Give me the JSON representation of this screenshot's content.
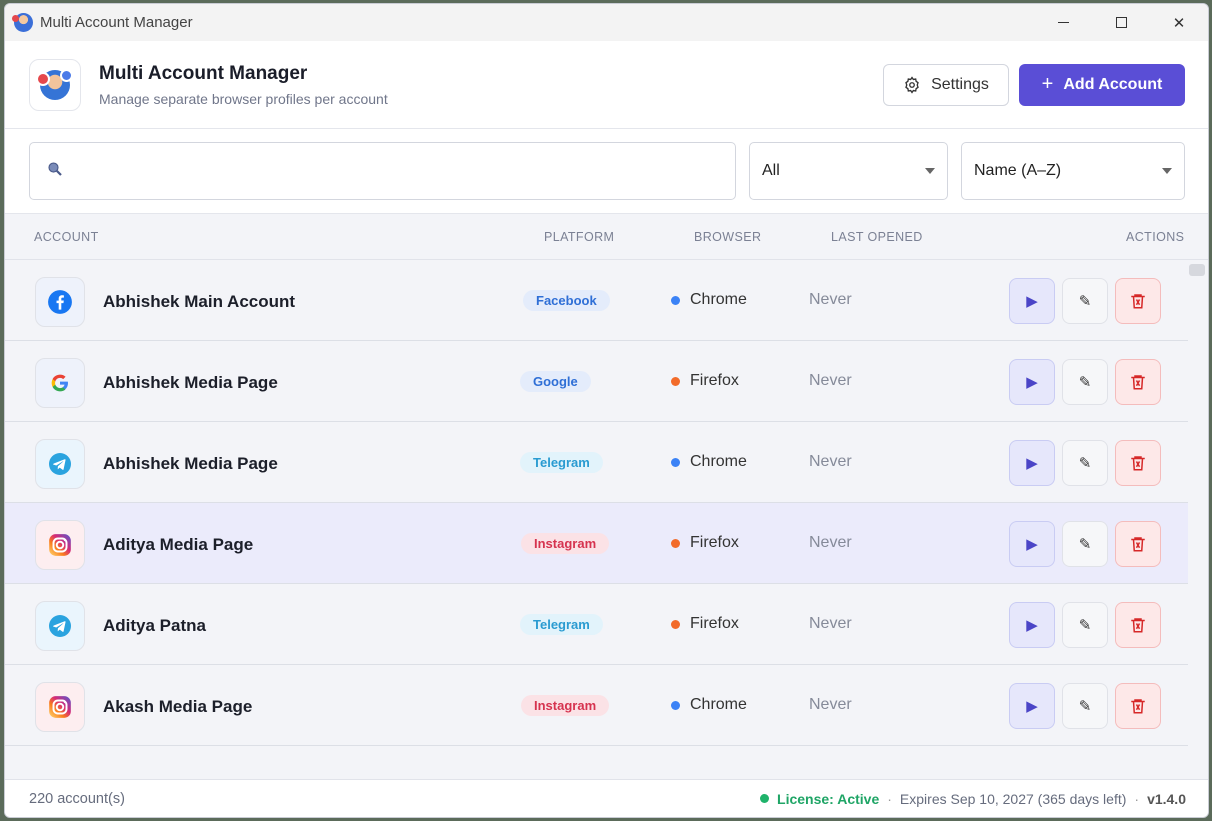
{
  "window": {
    "title": "Multi Account Manager"
  },
  "header": {
    "title": "Multi Account Manager",
    "subtitle": "Manage separate browser profiles per account",
    "settings_label": "Settings",
    "add_label": "Add Account",
    "add_plus": "+"
  },
  "filters": {
    "search_placeholder": "",
    "platform_value": "All",
    "sort_value": "Name (A–Z)"
  },
  "table": {
    "columns": {
      "account": "ACCOUNT",
      "platform": "PLATFORM",
      "browser": "BROWSER",
      "last_opened": "LAST OPENED",
      "actions": "ACTIONS"
    },
    "rows": [
      {
        "name": "Abhishek Main Account",
        "platform": "Facebook",
        "browser": "Chrome",
        "last_opened": "Never"
      },
      {
        "name": "Abhishek Media Page",
        "platform": "Google",
        "browser": "Firefox",
        "last_opened": "Never"
      },
      {
        "name": "Abhishek Media Page",
        "platform": "Telegram",
        "browser": "Chrome",
        "last_opened": "Never"
      },
      {
        "name": "Aditya Media Page",
        "platform": "Instagram",
        "browser": "Firefox",
        "last_opened": "Never"
      },
      {
        "name": "Aditya Patna",
        "platform": "Telegram",
        "browser": "Firefox",
        "last_opened": "Never"
      },
      {
        "name": "Akash Media Page",
        "platform": "Instagram",
        "browser": "Chrome",
        "last_opened": "Never"
      }
    ]
  },
  "footer": {
    "count": "220 account(s)",
    "license": "License: Active",
    "expires": "Expires Sep 10, 2027 (365 days left)",
    "version": "v1.4.0"
  },
  "colors": {
    "accent": "#5a4ed6",
    "chrome_dot": "#3b82f6",
    "firefox_dot": "#f26b2a",
    "license_green": "#1fb36b"
  }
}
